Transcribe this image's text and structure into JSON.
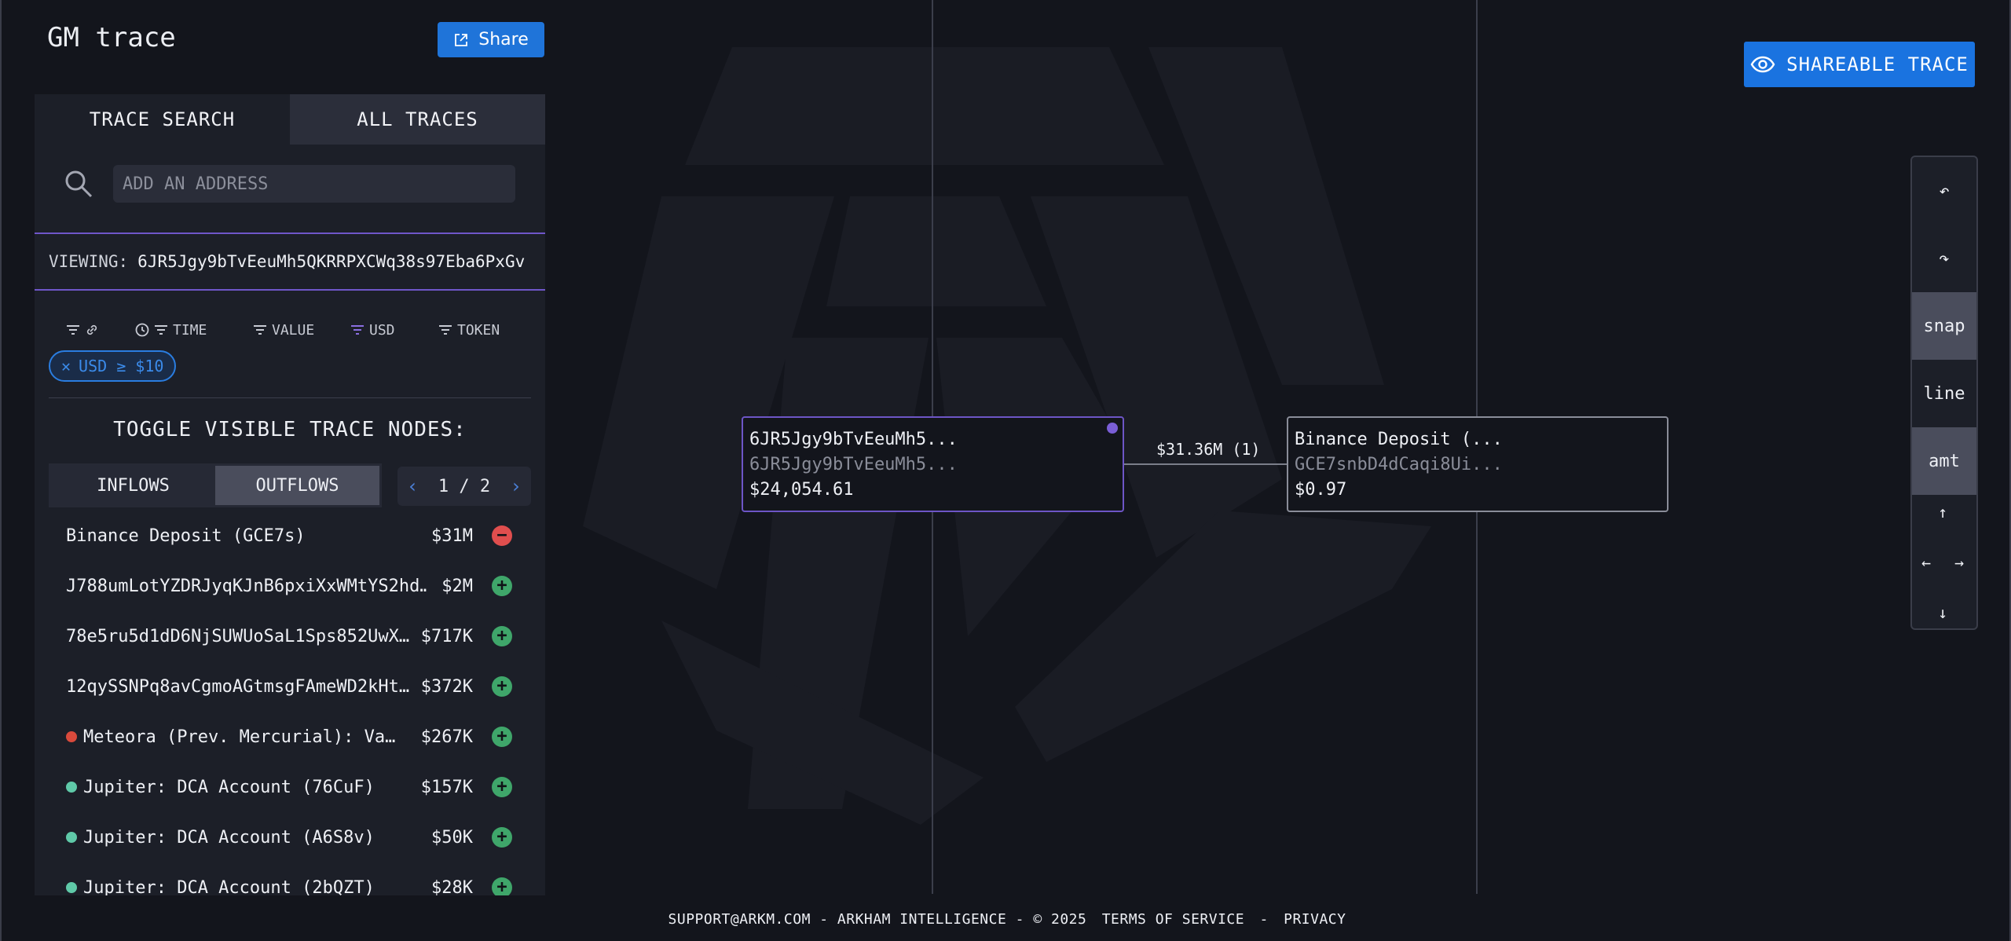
{
  "header": {
    "title": "GM trace",
    "share_label": "Share"
  },
  "sidebar": {
    "tabs": [
      {
        "label": "TRACE SEARCH",
        "active": true
      },
      {
        "label": "ALL TRACES",
        "active": false
      }
    ],
    "search": {
      "placeholder": "ADD AN ADDRESS"
    },
    "viewing": {
      "label": "VIEWING:",
      "address": "6JR5Jgy9bTvEeuMh5QKRRPXCWq38s97Eba6PxGv"
    },
    "filters": [
      {
        "label": "",
        "icon": "filter-link-icon"
      },
      {
        "label": "TIME",
        "icon": "clock-icon"
      },
      {
        "label": "VALUE",
        "icon": "filter-icon"
      },
      {
        "label": "USD",
        "icon": "filter-icon",
        "active": true
      },
      {
        "label": "TOKEN",
        "icon": "filter-icon"
      }
    ],
    "active_filter_chip": "USD ≥ $10",
    "toggle_title": "TOGGLE VISIBLE TRACE NODES:",
    "flow_toggle": {
      "inflows": "INFLOWS",
      "outflows": "OUTFLOWS",
      "selected": "outflows"
    },
    "pager": {
      "text": "1 / 2"
    },
    "rows": [
      {
        "name": "Binance Deposit (GCE7s)",
        "amount": "$31M",
        "action": "minus",
        "entity_color": ""
      },
      {
        "name": "J788umLotYZDRJyqKJnB6pxiXxWMtYS2hd…",
        "amount": "$2M",
        "action": "plus",
        "entity_color": ""
      },
      {
        "name": "78e5ru5d1dD6NjSUWUoSaL1Sps852UwX…",
        "amount": "$717K",
        "action": "plus",
        "entity_color": ""
      },
      {
        "name": "12qySSNPq8avCgmoAGtmsgFAmeWD2kHt…",
        "amount": "$372K",
        "action": "plus",
        "entity_color": ""
      },
      {
        "name": "Meteora (Prev. Mercurial): Va…",
        "amount": "$267K",
        "action": "plus",
        "entity_color": "#d94a3c"
      },
      {
        "name": "Jupiter: DCA Account (76CuF)",
        "amount": "$157K",
        "action": "plus",
        "entity_color": "#5fc9a8"
      },
      {
        "name": "Jupiter: DCA Account (A6S8v)",
        "amount": "$50K",
        "action": "plus",
        "entity_color": "#5fc9a8"
      },
      {
        "name": "Jupiter: DCA Account (2bQZT)",
        "amount": "$28K",
        "action": "plus",
        "entity_color": "#5fc9a8"
      }
    ]
  },
  "graph": {
    "nodes": [
      {
        "title": "6JR5Jgy9bTvEeuMh5...",
        "subtitle": "6JR5Jgy9bTvEeuMh5...",
        "value": "$24,054.61"
      },
      {
        "title": "Binance Deposit (...",
        "subtitle": "GCE7snbD4dCaqi8Ui...",
        "value": "$0.97"
      }
    ],
    "edge_label": "$31.36M (1)"
  },
  "shareable_label": "SHAREABLE TRACE",
  "controls": {
    "undo_icon": "undo-icon",
    "redo_icon": "redo-icon",
    "snap": "snap",
    "line": "line",
    "amt": "amt"
  },
  "footer": {
    "support": "SUPPORT@ARKM.COM - ARKHAM INTELLIGENCE - © 2025",
    "terms": "TERMS OF SERVICE",
    "sep": "-",
    "privacy": "PRIVACY"
  },
  "colors": {
    "accent": "#1f74d9",
    "node_selected": "#6d55c6",
    "plus": "#3fa66a",
    "minus": "#e04e4e"
  }
}
